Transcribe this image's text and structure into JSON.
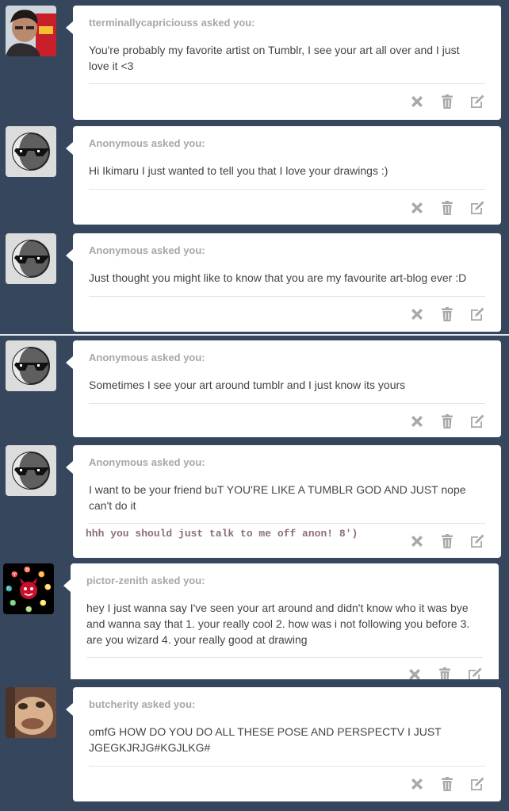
{
  "posts": [
    {
      "asker": "tterminallycapriciouss asked you:",
      "question": "You're probably my favorite artist on Tumblr, I see your art all over and I just love it <3",
      "avatar_icon": "photo-avatar-icon"
    },
    {
      "asker": "Anonymous asked you:",
      "question": "Hi Ikimaru I just wanted to tell you that I love your drawings :)",
      "avatar_icon": "anonymous-sunglasses-icon"
    },
    {
      "asker": "Anonymous asked you:",
      "question": "Just thought you might like to know that you are my favourite art-blog ever :D",
      "avatar_icon": "anonymous-sunglasses-icon"
    },
    {
      "asker": "Anonymous asked you:",
      "question": "Sometimes I see your art around tumblr and I just know its yours",
      "avatar_icon": "anonymous-sunglasses-icon"
    },
    {
      "asker": "Anonymous asked you:",
      "question": "I want to be your friend buT YOU'RE LIKE A TUMBLR GOD AND JUST nope can't do it",
      "reply_note": "hhh you should just talk to me off anon! 8')",
      "avatar_icon": "anonymous-sunglasses-icon"
    },
    {
      "asker": "pictor-zenith asked you:",
      "question": "hey I just wanna say I've seen your art around and didn't know who it was bye and wanna say that 1. your really cool 2. how was i not following you before 3. are you wizard 4. your really good at drawing",
      "avatar_icon": "zodiac-avatar-icon"
    },
    {
      "asker": "butcherity asked you:",
      "question": "omfG HOW DO YOU DO ALL THESE POSE AND PERSPECTV I JUST JGEGKJRJG#KGJLKG#",
      "avatar_icon": "photo-avatar-icon"
    }
  ],
  "action_icons": [
    "close-icon",
    "trash-icon",
    "edit-icon"
  ],
  "colors": {
    "background": "#36465d",
    "card": "#ffffff",
    "asker_text": "#a7a7a7",
    "question_text": "#444444",
    "icon": "#a9a9a9",
    "reply_note": "#8c6d7e"
  }
}
